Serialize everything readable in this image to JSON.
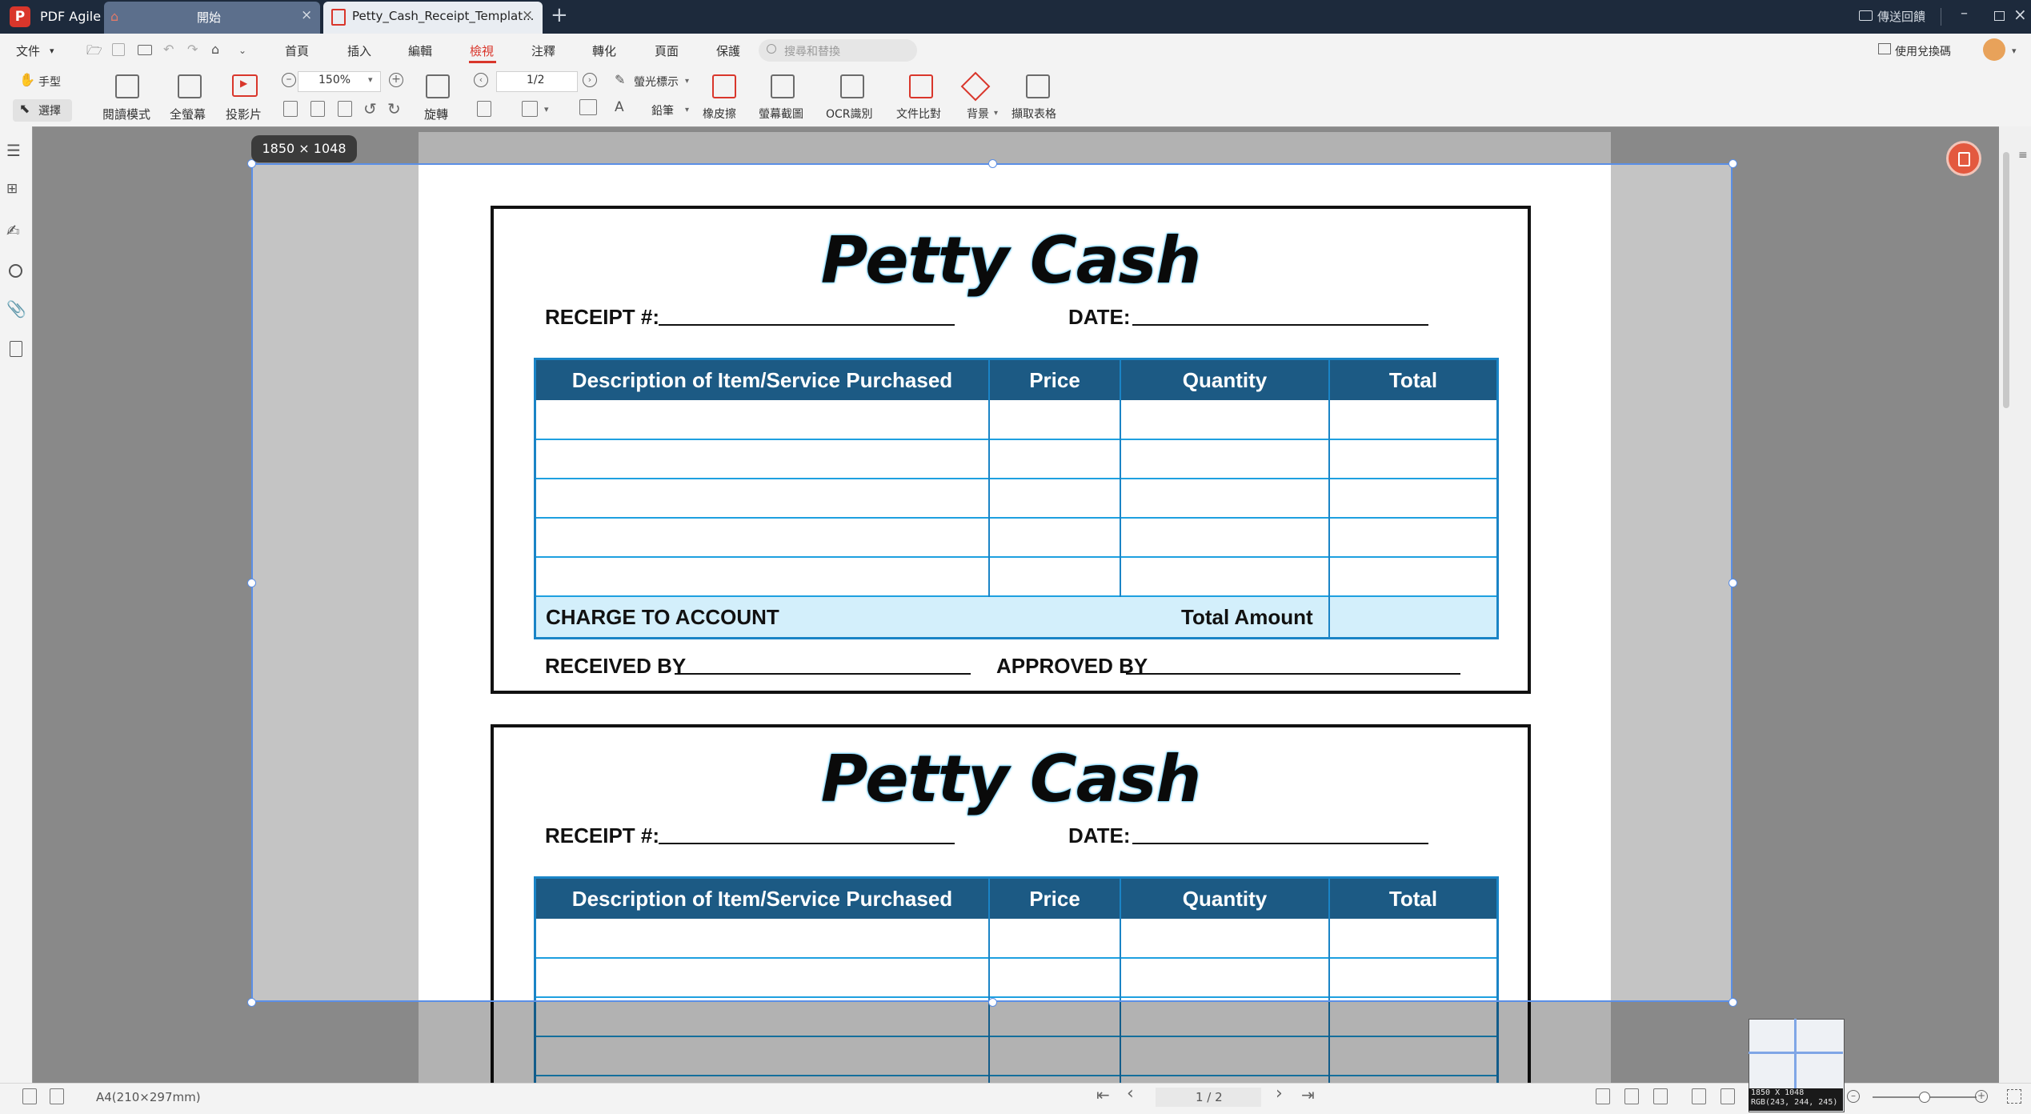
{
  "app": {
    "name": "PDF Agile"
  },
  "tabs": [
    {
      "label": "開始"
    },
    {
      "label": "Petty_Cash_Receipt_Templat..."
    }
  ],
  "titlebar": {
    "feedback": "傳送回饋"
  },
  "menu": {
    "file": "文件",
    "items": [
      "首頁",
      "插入",
      "編輯",
      "檢視",
      "注釋",
      "轉化",
      "頁面",
      "保護"
    ],
    "search_placeholder": "搜尋和替換",
    "redeem": "使用兌換碼"
  },
  "toolbar": {
    "hand": "手型",
    "select": "選擇",
    "read_mode": "閱讀模式",
    "fullscreen": "全螢幕",
    "slideshow": "投影片",
    "zoom": "150%",
    "rotate": "旋轉",
    "page_field": "1/2",
    "highlight": "螢光標示",
    "pencil": "鉛筆",
    "eraser": "橡皮擦",
    "screenshot": "螢幕截圖",
    "ocr": "OCR識別",
    "compare": "文件比對",
    "background": "背景",
    "extract_table": "擷取表格"
  },
  "selection": {
    "size_label": "1850 × 1048"
  },
  "receipt": {
    "title": "Petty Cash",
    "receipt_label": "RECEIPT #:",
    "date_label": "DATE:",
    "headers": [
      "Description of Item/Service Purchased",
      "Price",
      "Quantity",
      "Total"
    ],
    "charge_to_account": "CHARGE TO ACCOUNT",
    "total_amount": "Total Amount",
    "received_by": "RECEIVED BY",
    "approved_by": "APPROVED BY"
  },
  "status": {
    "page_size": "A4(210×297mm)",
    "page_indicator": "1 / 2"
  },
  "magnifier": {
    "line1": "1850 X 1048",
    "line2": "RGB(243, 244, 245)"
  },
  "colors": {
    "titlebar": "#1d2a3c",
    "brand": "#d9362b",
    "table_header": "#1c5a84",
    "table_border": "#1a84c6",
    "table_footer": "#d3effb",
    "selection": "#5b8fe6"
  }
}
